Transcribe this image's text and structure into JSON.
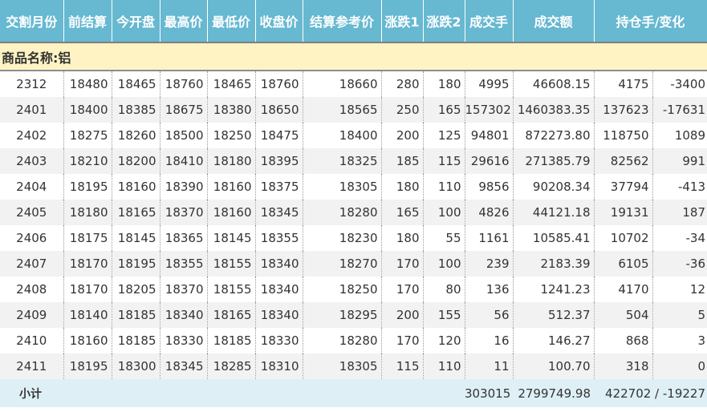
{
  "headers": [
    "交割月份",
    "前结算",
    "今开盘",
    "最高价",
    "最低价",
    "收盘价",
    "结算参考价",
    "涨跌1",
    "涨跌2",
    "成交手",
    "成交额",
    "持仓手/变化"
  ],
  "product_label": "商品名称:铝",
  "rows": [
    [
      "2312",
      "18480",
      "18465",
      "18760",
      "18465",
      "18760",
      "18660",
      "280",
      "180",
      "4995",
      "46608.15",
      "4175",
      "-3400"
    ],
    [
      "2401",
      "18400",
      "18385",
      "18675",
      "18380",
      "18650",
      "18565",
      "250",
      "165",
      "157302",
      "1460383.35",
      "137623",
      "-17631"
    ],
    [
      "2402",
      "18275",
      "18260",
      "18500",
      "18250",
      "18475",
      "18400",
      "200",
      "125",
      "94801",
      "872273.80",
      "118750",
      "1089"
    ],
    [
      "2403",
      "18210",
      "18200",
      "18410",
      "18180",
      "18395",
      "18325",
      "185",
      "115",
      "29616",
      "271385.79",
      "82562",
      "991"
    ],
    [
      "2404",
      "18195",
      "18160",
      "18390",
      "18160",
      "18375",
      "18305",
      "180",
      "110",
      "9856",
      "90208.34",
      "37794",
      "-413"
    ],
    [
      "2405",
      "18180",
      "18165",
      "18370",
      "18160",
      "18345",
      "18280",
      "165",
      "100",
      "4826",
      "44121.18",
      "19131",
      "187"
    ],
    [
      "2406",
      "18175",
      "18145",
      "18365",
      "18145",
      "18355",
      "18230",
      "180",
      "55",
      "1161",
      "10585.41",
      "10702",
      "-34"
    ],
    [
      "2407",
      "18170",
      "18195",
      "18355",
      "18155",
      "18340",
      "18270",
      "170",
      "100",
      "239",
      "2183.39",
      "6105",
      "-36"
    ],
    [
      "2408",
      "18170",
      "18205",
      "18370",
      "18155",
      "18340",
      "18250",
      "170",
      "80",
      "136",
      "1241.23",
      "4170",
      "12"
    ],
    [
      "2409",
      "18140",
      "18185",
      "18340",
      "18165",
      "18340",
      "18295",
      "200",
      "155",
      "56",
      "512.37",
      "504",
      "5"
    ],
    [
      "2410",
      "18160",
      "18185",
      "18330",
      "18185",
      "18330",
      "18280",
      "170",
      "120",
      "16",
      "146.27",
      "868",
      "3"
    ],
    [
      "2411",
      "18195",
      "18300",
      "18345",
      "18285",
      "18310",
      "18305",
      "115",
      "110",
      "11",
      "100.70",
      "318",
      "0"
    ]
  ],
  "subtotal": {
    "label": "小计",
    "volume": "303015",
    "turnover": "2799749.98",
    "position": "422702 / -19227"
  }
}
